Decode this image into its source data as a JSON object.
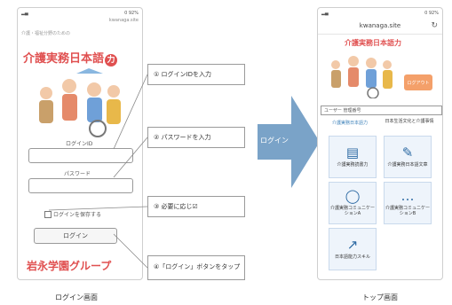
{
  "login_screen": {
    "status_time": "0 92%",
    "url": "kwanaga.site",
    "small_title": "介護・福祉分野のための",
    "app_name": "介護実務日本語",
    "app_name_suffix": "力",
    "login_id_label": "ログインID",
    "password_label": "パスワード",
    "remember_label": "ログインを保存する",
    "login_button": "ログイン",
    "group_name": "岩永学園グループ",
    "caption": "ログイン画面"
  },
  "steps": [
    {
      "label": "① ログインIDを入力"
    },
    {
      "label": "② パスワードを入力"
    },
    {
      "label": "③ 必要に応じ☑"
    },
    {
      "label": "④「ログイン」ボタンをタップ"
    }
  ],
  "arrow": {
    "label": "ログイン"
  },
  "top_screen": {
    "status_time": "0 92%",
    "site": "kwanaga.site",
    "app_name": "介護実務日本語力",
    "download_button": "ログアウト",
    "user_bar": "ユーザー 管理番号",
    "tab_left": "介護実務日本語力",
    "tab_right": "日本生活文化と介護事情",
    "tiles": [
      {
        "icon": "▤",
        "label": "介護実務読書力"
      },
      {
        "icon": "✎",
        "label": "介護実務日本語文章"
      },
      {
        "icon": "◯",
        "label": "介護実務コミュニケーションA"
      },
      {
        "icon": "…",
        "label": "介護実務コミュニケーションB"
      },
      {
        "icon": "↗",
        "label": "日本語能力スキル"
      }
    ],
    "caption": "トップ画面"
  },
  "colors": {
    "brand_red": "#e05050",
    "tile_blue": "#2d6aa3",
    "arrow": "#7aa3c8"
  }
}
